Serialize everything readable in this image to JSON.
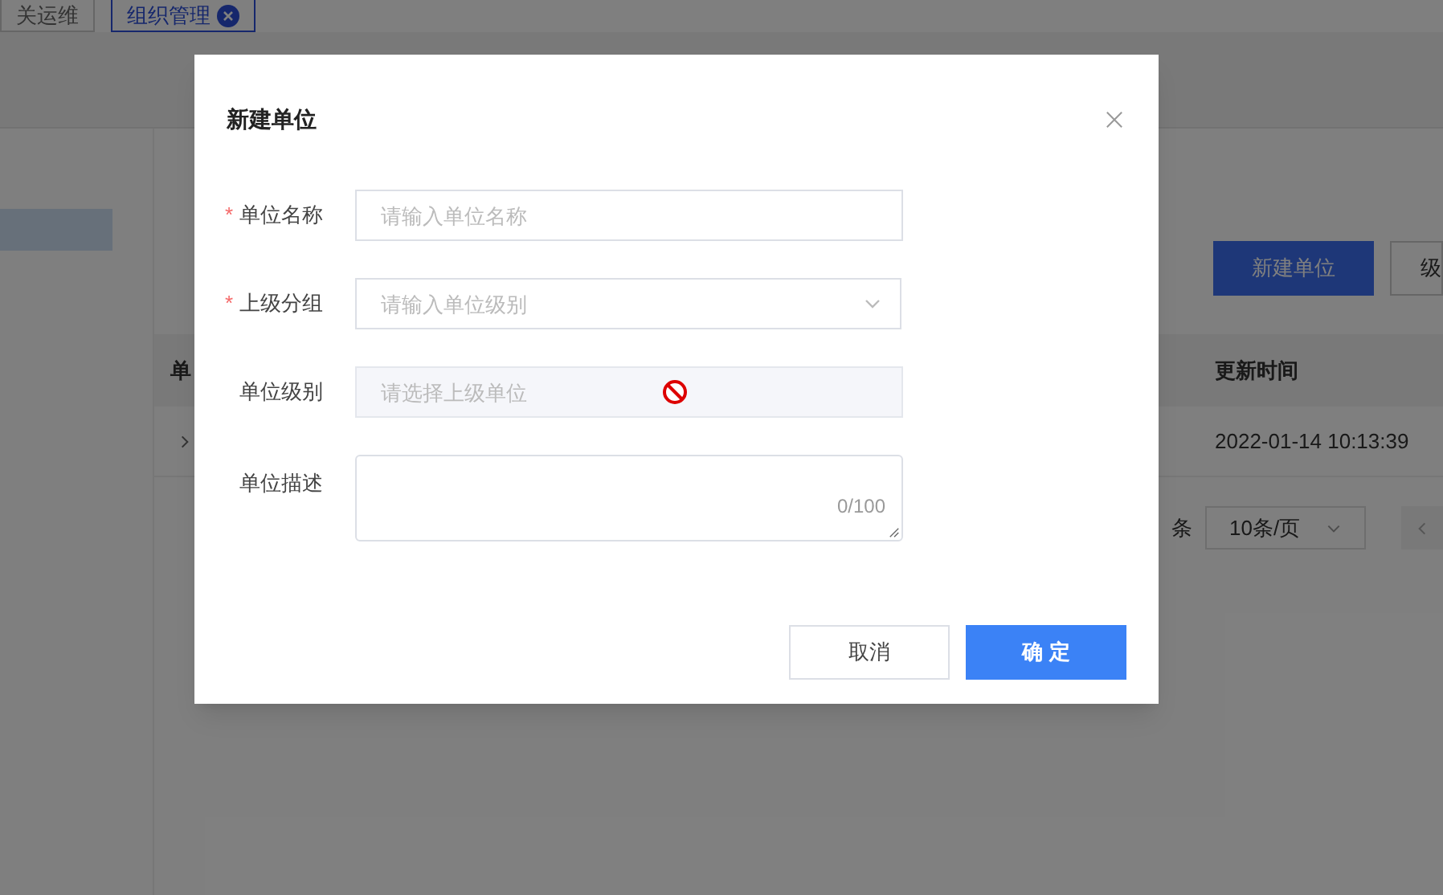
{
  "background": {
    "tabs": [
      {
        "label": "关运维",
        "selected": false
      },
      {
        "label": "组织管理",
        "selected": true
      }
    ],
    "actions": [
      {
        "label": "新建单位",
        "primary": true
      },
      {
        "label": "级",
        "primary": false
      }
    ],
    "table": {
      "columns": [
        "单",
        "更新时间"
      ],
      "rows": [
        {
          "updated": "2022-01-14 10:13:39"
        }
      ]
    },
    "pagination": {
      "suffix": "条",
      "page_size": "10条/页"
    }
  },
  "dialog": {
    "title": "新建单位",
    "fields": [
      {
        "kind": "input",
        "marker": "*",
        "label": "单位名称",
        "placeholder": "请输入单位名称"
      },
      {
        "kind": "select",
        "marker": "*",
        "label": "上级分组",
        "placeholder": "请输入单位级别"
      },
      {
        "kind": "input",
        "label": "单位级别",
        "placeholder": "请选择上级单位",
        "disabled": true
      },
      {
        "kind": "textarea",
        "label": "单位描述",
        "counter": "0/100"
      }
    ],
    "buttons": [
      {
        "label": "取消",
        "primary": false
      },
      {
        "label": "确 定",
        "primary": true
      }
    ]
  }
}
